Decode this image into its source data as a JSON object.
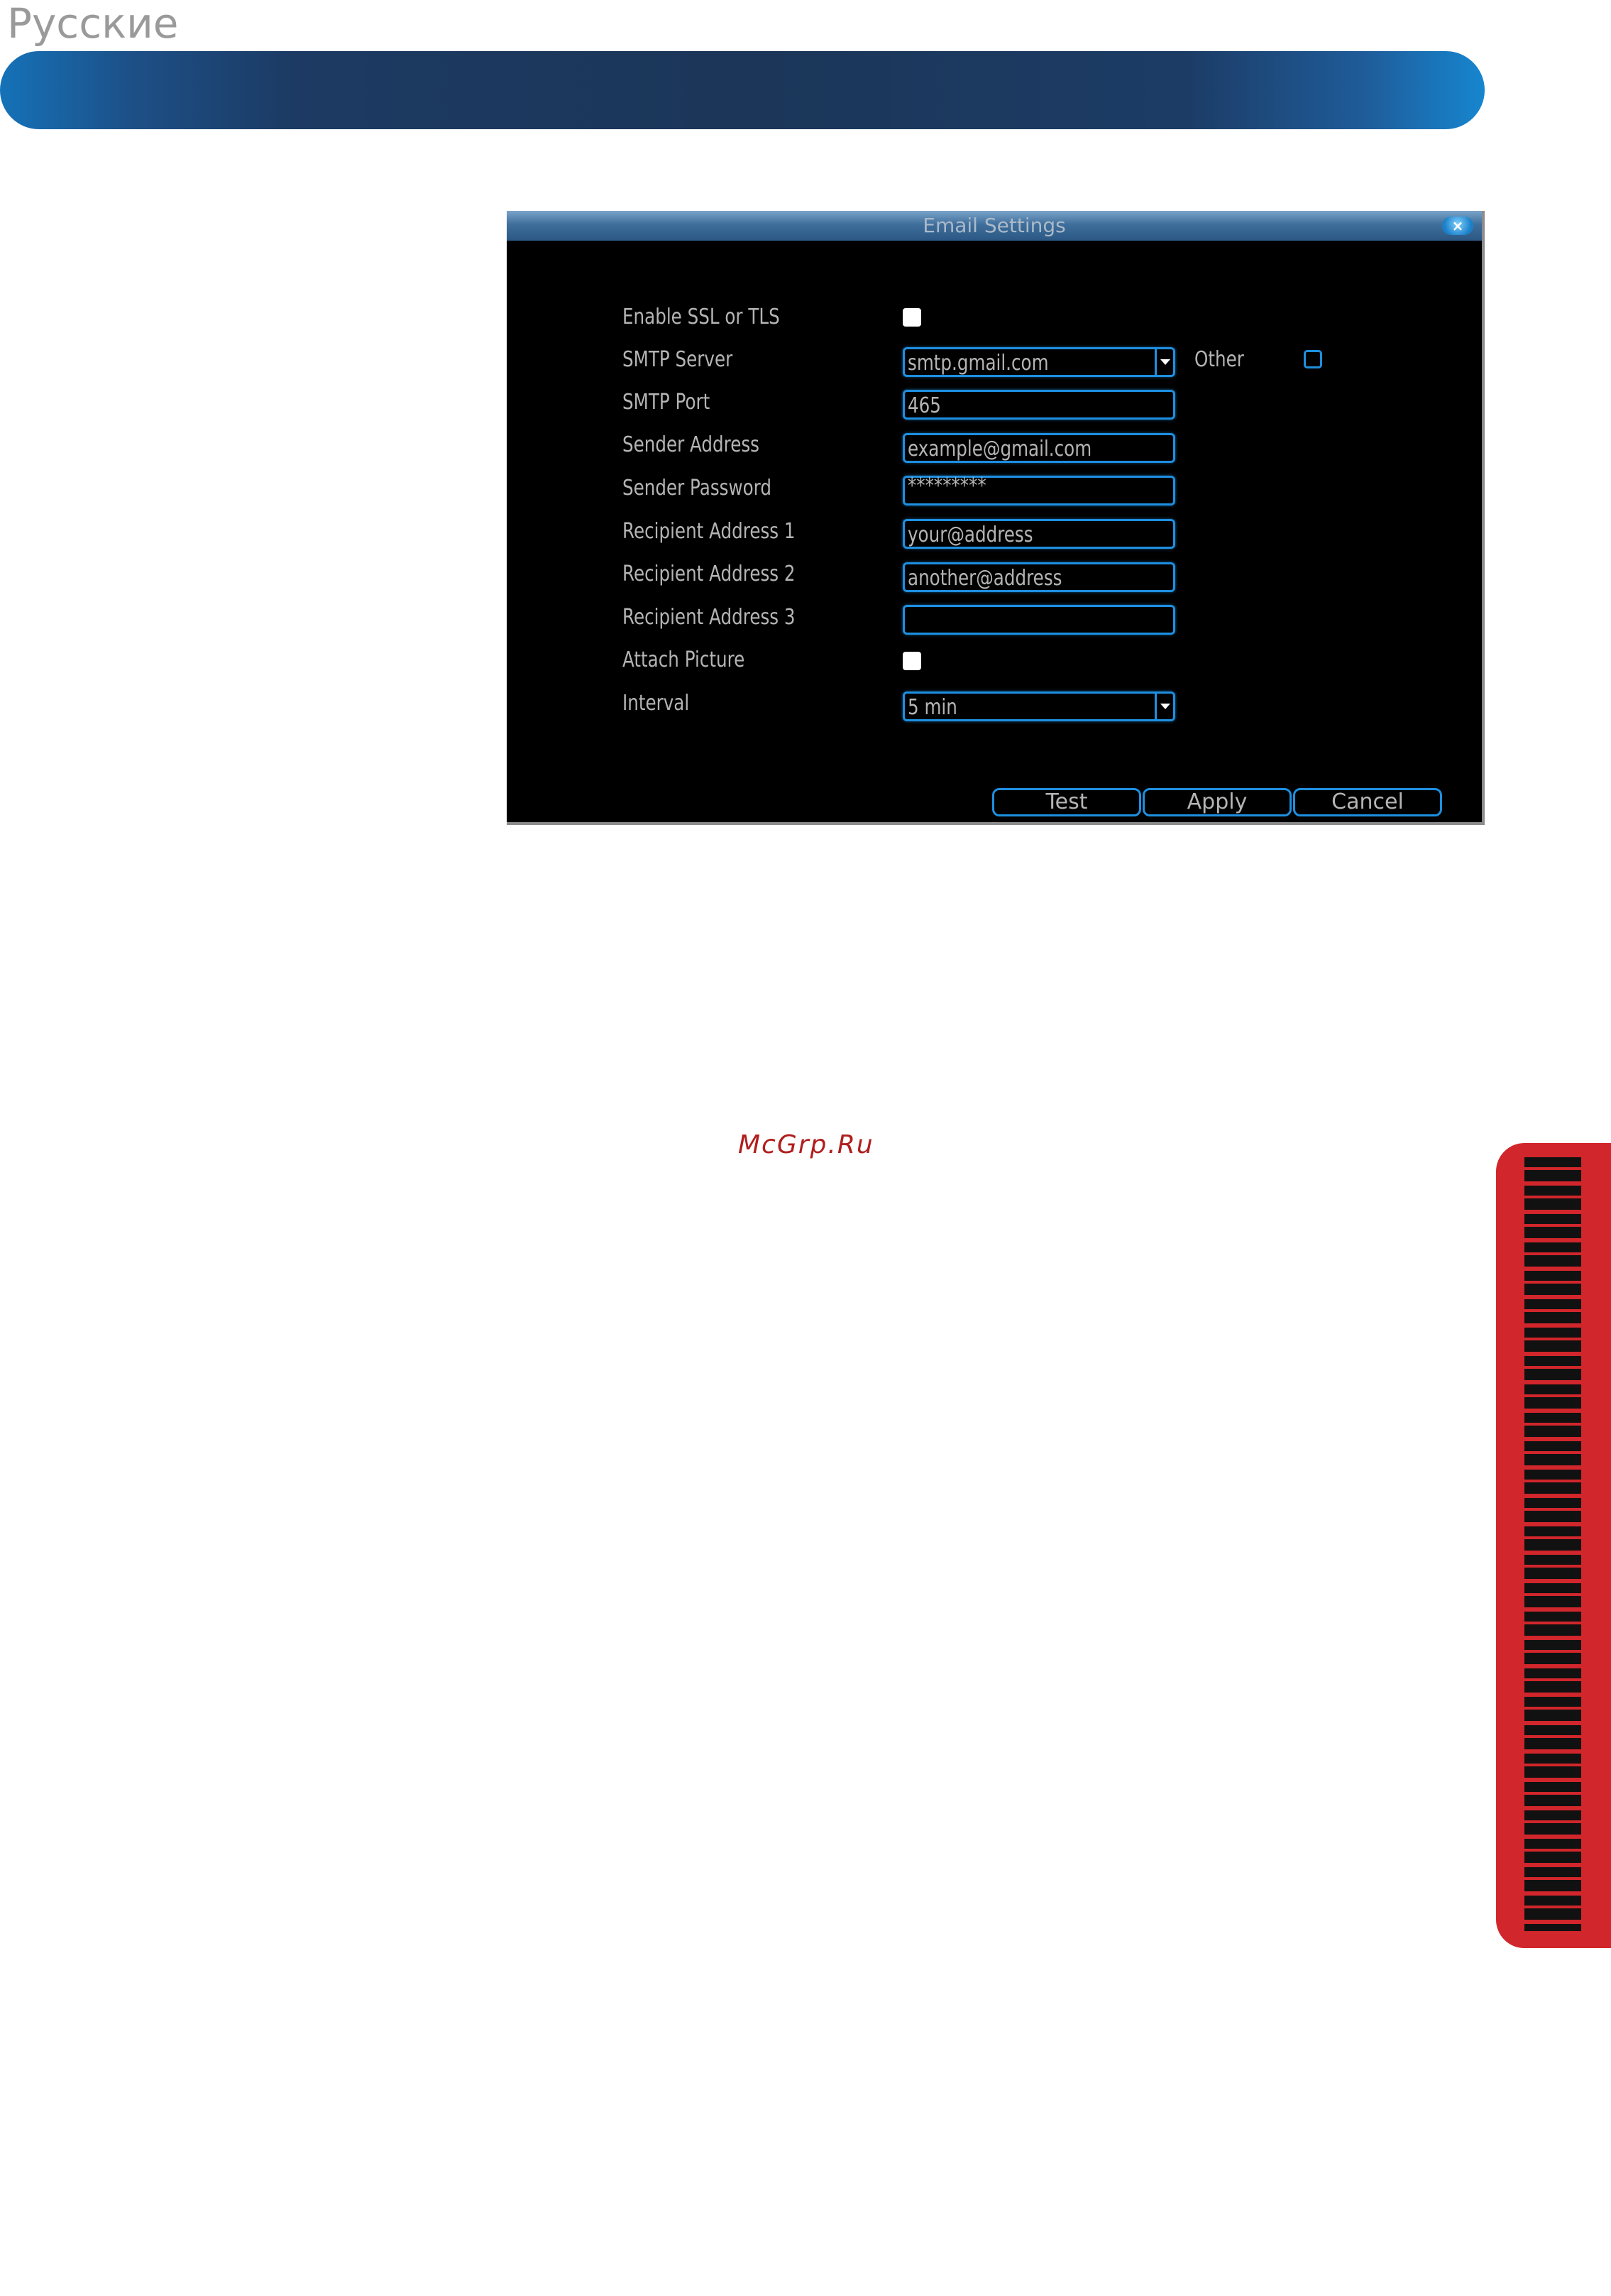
{
  "page": {
    "language_title": "Русские",
    "watermark": "McGrp.Ru"
  },
  "dialog": {
    "title": "Email Settings",
    "close_label": "×",
    "rows": {
      "ssl": {
        "label": "Enable SSL or TLS",
        "checked": false
      },
      "smtp_server": {
        "label": "SMTP Server",
        "value": "smtp.gmail.com"
      },
      "other": {
        "label": "Other",
        "checked": false
      },
      "smtp_port": {
        "label": "SMTP Port",
        "value": "465"
      },
      "sender_address": {
        "label": "Sender Address",
        "value": "example@gmail.com"
      },
      "sender_password": {
        "label": "Sender Password",
        "value": "*********"
      },
      "recipient1": {
        "label": "Recipient Address 1",
        "value": "your@address"
      },
      "recipient2": {
        "label": "Recipient Address 2",
        "value": "another@address"
      },
      "recipient3": {
        "label": "Recipient Address 3",
        "value": ""
      },
      "attach_picture": {
        "label": "Attach Picture",
        "checked": false
      },
      "interval": {
        "label": "Interval",
        "value": "5 min"
      }
    },
    "buttons": {
      "test": "Test",
      "apply": "Apply",
      "cancel": "Cancel"
    }
  },
  "colors": {
    "accent_blue": "#1e8fe0",
    "dialog_background": "#000000",
    "side_tab_red": "#d1262b",
    "watermark_red": "#b01e1e"
  }
}
